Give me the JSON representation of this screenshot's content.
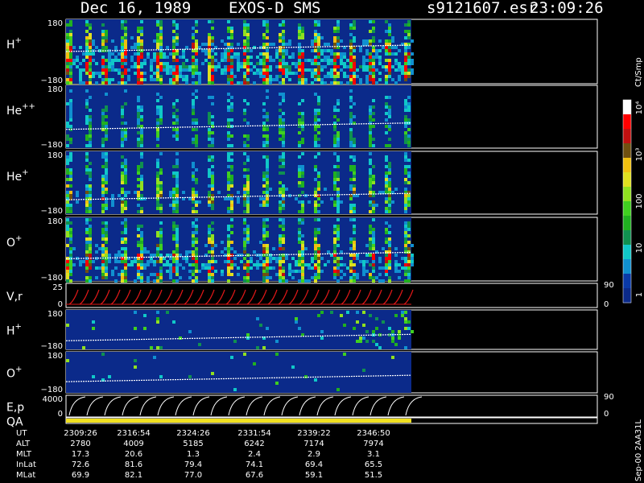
{
  "header": {
    "date": "Dec 16, 1989",
    "instrument": "EXOS-D SMS",
    "file": "s9121607.esr",
    "time": "23:09:26"
  },
  "colors": {
    "background": "#000000",
    "panel_fill": "#0b2a8a",
    "trace_white": "#ffffff",
    "trace_red": "#e01818",
    "qa_bar": "#f0e020"
  },
  "chart_data": {
    "type": "heatmap",
    "time_ticks": [
      "2309:26",
      "2316:54",
      "2324:26",
      "2331:54",
      "2339:22",
      "2346:50"
    ],
    "panels": [
      {
        "id": "hplus-top",
        "label": "H",
        "sup": "+",
        "ymax": "180",
        "ymin": "−180",
        "kind": "spectrogram",
        "intensity": 0.85,
        "burst": 0.7,
        "trace": 0.45
      },
      {
        "id": "heplusplus",
        "label": "He",
        "sup": "++",
        "ymax": "180",
        "ymin": "−180",
        "kind": "spectrogram",
        "intensity": 0.35,
        "burst": 0.5,
        "trace": 0.65
      },
      {
        "id": "heplus",
        "label": "He",
        "sup": "+",
        "ymax": "180",
        "ymin": "−180",
        "kind": "spectrogram",
        "intensity": 0.55,
        "burst": 0.6,
        "trace": 0.72
      },
      {
        "id": "oplus-top",
        "label": "O",
        "sup": "+",
        "ymax": "180",
        "ymin": "−180",
        "kind": "spectrogram",
        "intensity": 0.7,
        "burst": 0.8,
        "trace": 0.6
      },
      {
        "id": "vr",
        "label": "V,r",
        "sup": "",
        "ymax": "25",
        "ymin": "0",
        "right_max": "90",
        "right_min": "0",
        "kind": "trace"
      },
      {
        "id": "hplus-bot",
        "label": "H",
        "sup": "+",
        "ymax": "180",
        "ymin": "−180",
        "kind": "sparse",
        "intensity": 0.15,
        "trace": 0.7
      },
      {
        "id": "oplus-bot",
        "label": "O",
        "sup": "+",
        "ymax": "180",
        "ymin": "−180",
        "kind": "sparse",
        "intensity": 0.0,
        "trace": 0.65
      },
      {
        "id": "ep",
        "label": "E,p",
        "sup": "",
        "ymax": "4000",
        "ymin": "0",
        "right_max": "90",
        "right_min": "0",
        "kind": "sawtooth"
      },
      {
        "id": "qa",
        "label": "QA",
        "sup": "",
        "kind": "qa"
      }
    ],
    "colorbar": {
      "label": "Ct/Smp",
      "ticks": [
        "1",
        "10",
        "100",
        "10³",
        "10⁴"
      ],
      "colors": [
        "#0b2a8a",
        "#0a3aa8",
        "#1090d0",
        "#10c8c8",
        "#109050",
        "#20b020",
        "#40d020",
        "#90e020",
        "#e0e020",
        "#f0c010",
        "#705010",
        "#c01010",
        "#ff0000",
        "#ffffff"
      ]
    },
    "table": {
      "rows": [
        {
          "name": "UT",
          "values": [
            "2309:26",
            "2316:54",
            "2324:26",
            "2331:54",
            "2339:22",
            "2346:50"
          ]
        },
        {
          "name": "ALT",
          "values": [
            "2780",
            "4009",
            "5185",
            "6242",
            "7174",
            "7974"
          ]
        },
        {
          "name": "MLT",
          "values": [
            "17.3",
            "20.6",
            "1.3",
            "2.4",
            "2.9",
            "3.1"
          ]
        },
        {
          "name": "InLat",
          "values": [
            "72.6",
            "81.6",
            "79.4",
            "74.1",
            "69.4",
            "65.5"
          ]
        },
        {
          "name": "MLat",
          "values": [
            "69.9",
            "82.1",
            "77.0",
            "67.6",
            "59.1",
            "51.5"
          ]
        }
      ]
    },
    "footer": "Sep-00 2AA31L"
  }
}
